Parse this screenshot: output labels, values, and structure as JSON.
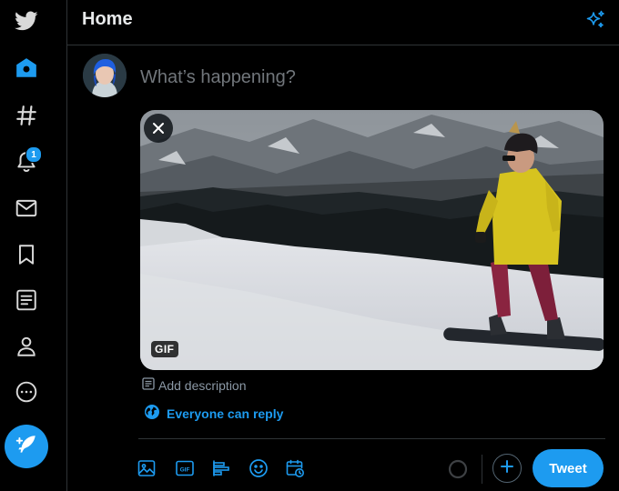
{
  "header": {
    "title": "Home"
  },
  "composer": {
    "placeholder": "What’s happening?"
  },
  "notifications": {
    "badge_count": "1"
  },
  "media": {
    "badge": "GIF",
    "add_description": "Add description"
  },
  "reply_setting": {
    "label": "Everyone can reply"
  },
  "actions": {
    "tweet_label": "Tweet"
  },
  "icons": {
    "nav": [
      "twitter-logo-icon",
      "home-icon",
      "hashtag-icon",
      "bell-icon",
      "mail-icon",
      "bookmark-icon",
      "list-icon",
      "profile-icon",
      "more-icon",
      "compose-icon"
    ],
    "toolbar": [
      "image-icon",
      "gif-icon",
      "poll-icon",
      "emoji-icon",
      "schedule-icon"
    ]
  },
  "colors": {
    "accent": "#1d9bf0",
    "background": "#000000",
    "border": "#2f3336",
    "muted_text": "#71767b"
  }
}
